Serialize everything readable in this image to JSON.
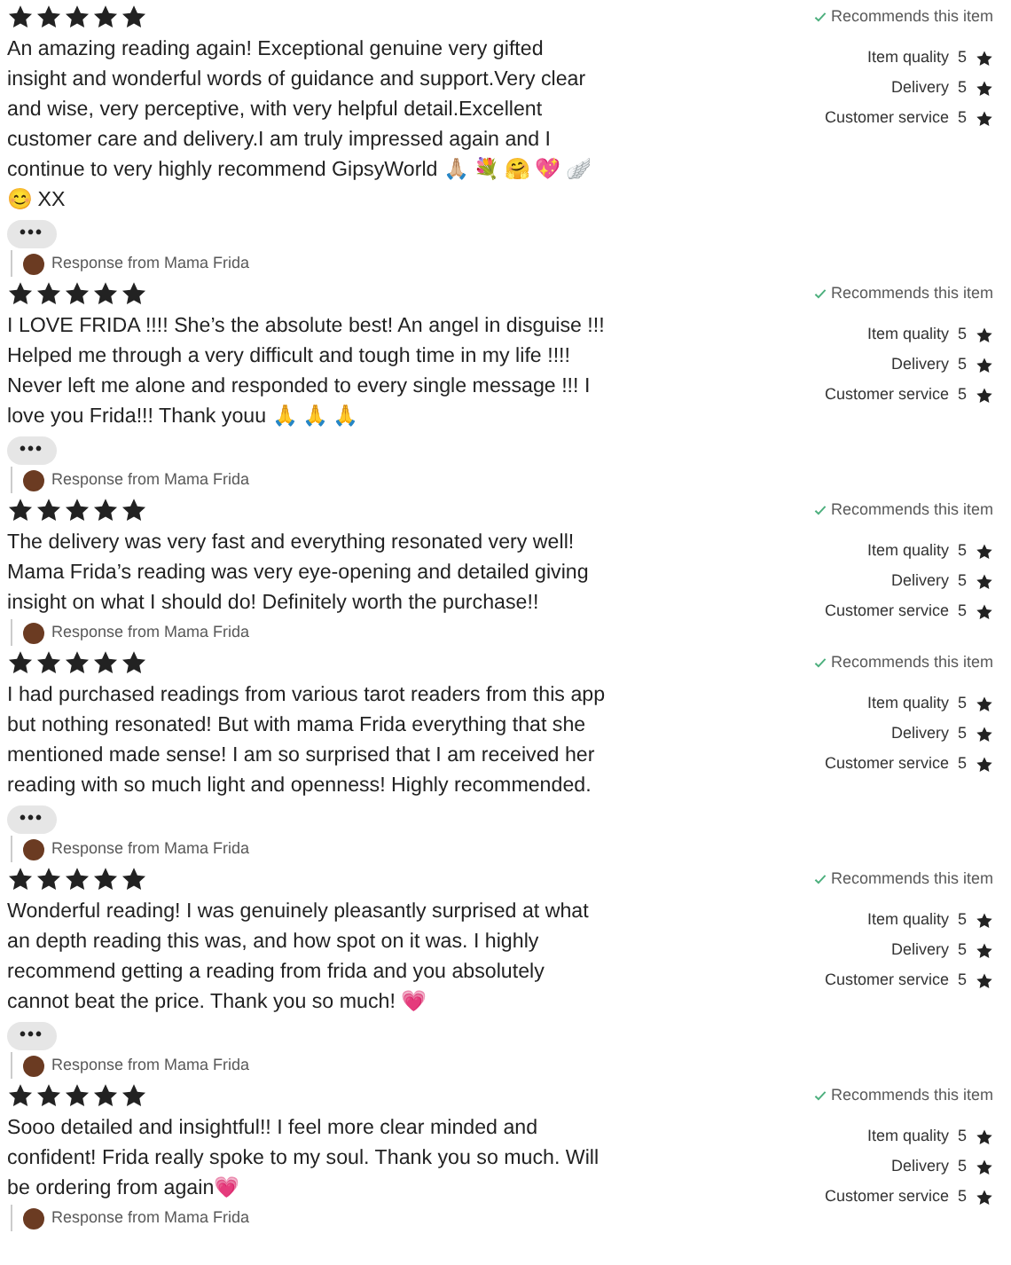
{
  "reviews": [
    {
      "stars": 5,
      "text": "An amazing reading again! Exceptional genuine very gifted insight and wonderful words of guidance and support.Very clear and wise, very perceptive, with very helpful detail.Excellent customer care and delivery.I am truly impressed again and I continue to very highly recommend GipsyWorld 🙏🏼 💐 🤗 💖 🪽 😊 XX",
      "more": "•••",
      "response": "Response from Mama Frida",
      "recommends": "Recommends this item",
      "ratings": [
        {
          "label": "Item quality",
          "value": "5"
        },
        {
          "label": "Delivery",
          "value": "5"
        },
        {
          "label": "Customer service",
          "value": "5"
        }
      ]
    },
    {
      "stars": 5,
      "text": "I LOVE FRIDA !!!! She’s the absolute best! An angel in disguise !!! Helped me through a very difficult and tough time in my life !!!! Never left me alone and responded to every single message !!! I love you Frida!!! Thank youu 🙏 🙏 🙏",
      "more": "•••",
      "response": "Response from Mama Frida",
      "recommends": "Recommends this item",
      "ratings": [
        {
          "label": "Item quality",
          "value": "5"
        },
        {
          "label": "Delivery",
          "value": "5"
        },
        {
          "label": "Customer service",
          "value": "5"
        }
      ]
    },
    {
      "stars": 5,
      "text": "The delivery was very fast and everything resonated very well! Mama Frida’s reading was very eye-opening and detailed giving insight on what I should do! Definitely worth the purchase!!",
      "response": "Response from Mama Frida",
      "recommends": "Recommends this item",
      "ratings": [
        {
          "label": "Item quality",
          "value": "5"
        },
        {
          "label": "Delivery",
          "value": "5"
        },
        {
          "label": "Customer service",
          "value": "5"
        }
      ]
    },
    {
      "stars": 5,
      "text": "I had purchased readings from various tarot readers from this app but nothing resonated! But with mama Frida everything that she mentioned made sense! I am so surprised that I am received her reading with so much light and openness! Highly recommended.",
      "more": "•••",
      "response": "Response from Mama Frida",
      "recommends": "Recommends this item",
      "ratings": [
        {
          "label": "Item quality",
          "value": "5"
        },
        {
          "label": "Delivery",
          "value": "5"
        },
        {
          "label": "Customer service",
          "value": "5"
        }
      ]
    },
    {
      "stars": 5,
      "text": "Wonderful reading! I was genuinely pleasantly surprised at what an depth reading this was, and how spot on it was. I highly recommend getting a reading from frida and you absolutely cannot beat the price. Thank you so much! 💗",
      "more": "•••",
      "response": "Response from Mama Frida",
      "recommends": "Recommends this item",
      "ratings": [
        {
          "label": "Item quality",
          "value": "5"
        },
        {
          "label": "Delivery",
          "value": "5"
        },
        {
          "label": "Customer service",
          "value": "5"
        }
      ]
    },
    {
      "stars": 5,
      "text": "Sooo detailed and insightful!! I feel more clear minded and confident! Frida really spoke to my soul. Thank you so much. Will be ordering from again💗",
      "response": "Response from Mama Frida",
      "recommends": "Recommends this item",
      "ratings": [
        {
          "label": "Item quality",
          "value": "5"
        },
        {
          "label": "Delivery",
          "value": "5"
        },
        {
          "label": "Customer service",
          "value": "5"
        }
      ]
    }
  ]
}
